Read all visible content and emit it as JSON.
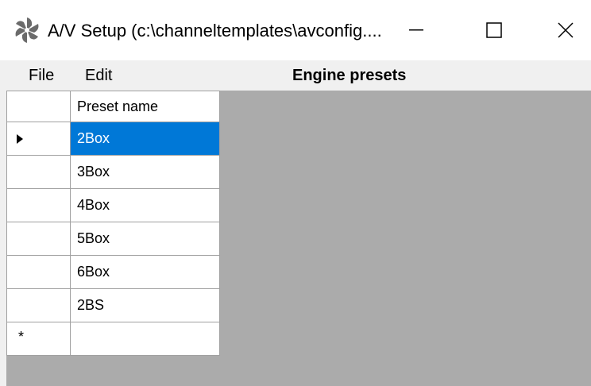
{
  "window": {
    "title": "A/V Setup (c:\\channeltemplates\\avconfig....",
    "icon": "pinwheel-icon",
    "controls": [
      "minimize-icon",
      "maximize-icon",
      "close-icon"
    ]
  },
  "menu": {
    "file": "File",
    "edit": "Edit",
    "section_title": "Engine presets"
  },
  "grid": {
    "column_header": "Preset name",
    "rows": [
      "2Box",
      "3Box",
      "4Box",
      "5Box",
      "6Box",
      "2BS"
    ],
    "selected_row": "2Box",
    "new_row_marker": "*"
  },
  "colors": {
    "selection": "#0078d7",
    "grid_background": "#ababab"
  }
}
